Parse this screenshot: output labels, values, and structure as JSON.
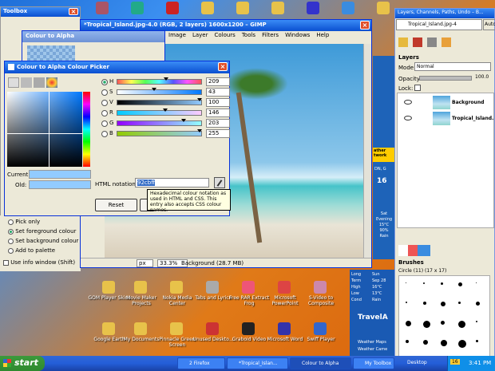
{
  "desktop": {
    "top_icons": [
      "#a56",
      "#2a8",
      "#c22",
      "#e8c24a",
      "#e8c24a",
      "#e8c24a",
      "#33c",
      "#3a8ce0",
      "#e8c24a"
    ],
    "icons": [
      {
        "label": "GOM Player Skins",
        "color": "#e8c24a"
      },
      {
        "label": "Movie Maker Projects",
        "color": "#e8c24a"
      },
      {
        "label": "Nokia Media Center",
        "color": "#e8c24a"
      },
      {
        "label": "Tabs and Lyrics",
        "color": "#aaa"
      },
      {
        "label": "Free RAR Extract Frog",
        "color": "#e57"
      },
      {
        "label": "Microsoft PowerPoint",
        "color": "#d44"
      },
      {
        "label": "S-Video to Composite",
        "color": "#c8a"
      },
      {
        "label": "Google Earth",
        "color": "#e8c24a"
      },
      {
        "label": "My Documents",
        "color": "#e8c24a"
      },
      {
        "label": "Pinnacle Green Screen",
        "color": "#e8c24a"
      },
      {
        "label": "Unused Deskto...",
        "color": "#c33"
      },
      {
        "label": "Graboid Video",
        "color": "#222"
      },
      {
        "label": "Microsoft Word",
        "color": "#33a"
      },
      {
        "label": "Swiff Player",
        "color": "#36c"
      }
    ]
  },
  "toolbox": {
    "title": "Toolbox",
    "options": [
      "Pick only",
      "Set foreground colour",
      "Set background colour",
      "Add to palette"
    ],
    "use_info": "Use info window  (Shift)"
  },
  "c2a": {
    "title": "Colour to Alpha"
  },
  "gimp": {
    "title": "*Tropical_Island.jpg-4.0 (RGB, 2 layers) 1600x1200 – GIMP",
    "menu": [
      "Image",
      "Layer",
      "Colours",
      "Tools",
      "Filters",
      "Windows",
      "Help"
    ],
    "unit": "px",
    "zoom": "33.3%",
    "status": "Background (28.7 MB)"
  },
  "picker": {
    "title": "Colour to Alpha Colour Picker",
    "channels": [
      {
        "key": "H",
        "value": "209",
        "checked": true
      },
      {
        "key": "S",
        "value": "43",
        "checked": false
      },
      {
        "key": "V",
        "value": "100",
        "checked": false
      },
      {
        "key": "R",
        "value": "146",
        "checked": false
      },
      {
        "key": "G",
        "value": "203",
        "checked": false
      },
      {
        "key": "B",
        "value": "255",
        "checked": false
      }
    ],
    "current_label": "Current:",
    "old_label": "Old:",
    "html_label": "HTML notation:",
    "html_value": "92cbff",
    "tooltip": "Hexadecimal colour notation as used in HTML and CSS.  This entry also accepts CSS colour names.",
    "reset": "Reset",
    "current_color": "#92cbff"
  },
  "layers": {
    "title": "Layers, Channels, Paths, Undo – B...",
    "image_select": "Tropical_Island.jpg-4",
    "auto": "Auto",
    "header": "Layers",
    "mode_label": "Mode:",
    "mode_value": "Normal",
    "opacity_label": "Opacity:",
    "opacity_value": "100.0",
    "lock_label": "Lock:",
    "items": [
      {
        "name": "Background"
      },
      {
        "name": "Tropical_Island.jpg-"
      }
    ],
    "brushes_header": "Brushes",
    "brush_name": "Circle (11) (17 x 17)",
    "brush_size": "11"
  },
  "weather": {
    "sat_lines": [
      "Sat",
      "Evening",
      "15°C",
      "90%",
      "Rain"
    ],
    "sun_lines": [
      "Sun",
      "Sep 28",
      "16°C",
      "13°C",
      "Rain"
    ],
    "label_lines": [
      "Long",
      "Term",
      "High",
      "Low",
      "Cond"
    ],
    "ad": "TravelA",
    "maps": "Weather Maps",
    "cam": "Weather Came",
    "temp": "16",
    "colour_label": "ather twork",
    "shown": "DN, G"
  },
  "taskbar": {
    "start": "start",
    "items": [
      "2 Firefox",
      "*Tropical_Islan...",
      "Colour to Alpha",
      "My Toolbox",
      "Desktop"
    ],
    "badge": "16",
    "clock": "3:41 PM",
    "extra": "16"
  }
}
